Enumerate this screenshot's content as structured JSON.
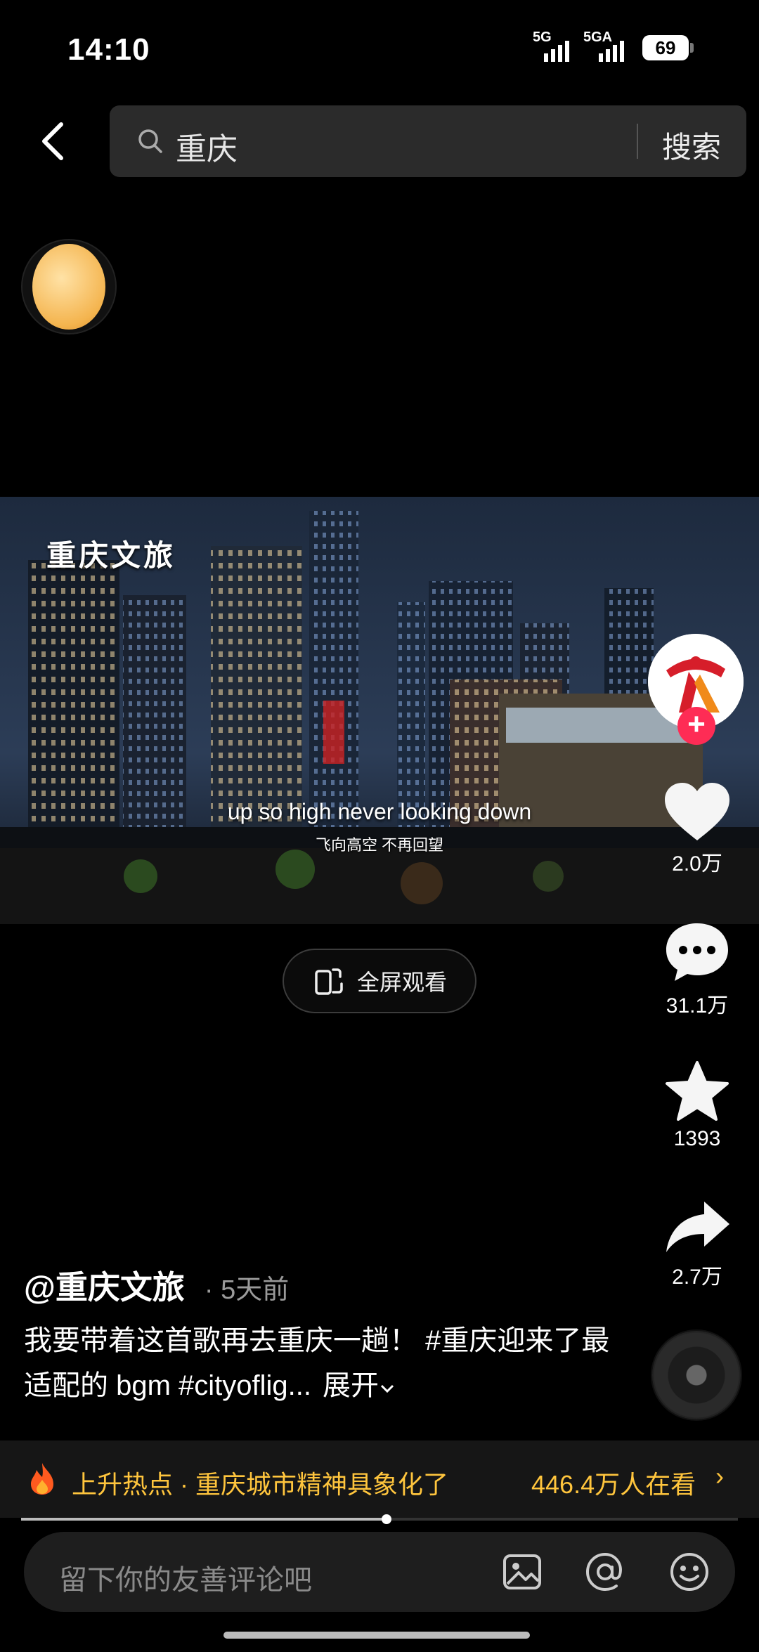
{
  "status": {
    "time": "14:10",
    "signal1": "5G",
    "signal2": "5GA",
    "battery": "69"
  },
  "search": {
    "query": "重庆",
    "button": "搜索"
  },
  "video": {
    "watermark": "重庆文旅",
    "subtitle_en": "up so high never looking down",
    "subtitle_zh": "飞向高空 不再回望",
    "fullscreen_label": "全屏观看"
  },
  "actions": {
    "likes": "2.0万",
    "comments": "31.1万",
    "favorites": "1393",
    "shares": "2.7万",
    "follow": "+"
  },
  "post": {
    "author": "@重庆文旅",
    "time": "· 5天前",
    "caption": "我要带着这首歌再去重庆一趟！ #重庆迎来了最适配的 bgm #cityoflig...",
    "expand": "展开"
  },
  "hot": {
    "label": "上升热点 · 重庆城市精神具象化了",
    "viewers": "446.4万人在看",
    "chevron": "›"
  },
  "progress": {
    "fraction": 0.51
  },
  "comment": {
    "placeholder": "留下你的友善评论吧"
  },
  "colors": {
    "hot": "#ffc53d",
    "follow": "#fe2c55",
    "background": "#000000"
  },
  "icons": [
    "back-icon",
    "search-icon",
    "heart-icon",
    "comment-icon",
    "star-icon",
    "share-icon",
    "image-icon",
    "at-icon",
    "emoji-icon",
    "fire-icon",
    "rotate-phone-icon",
    "chevron-down-icon"
  ]
}
